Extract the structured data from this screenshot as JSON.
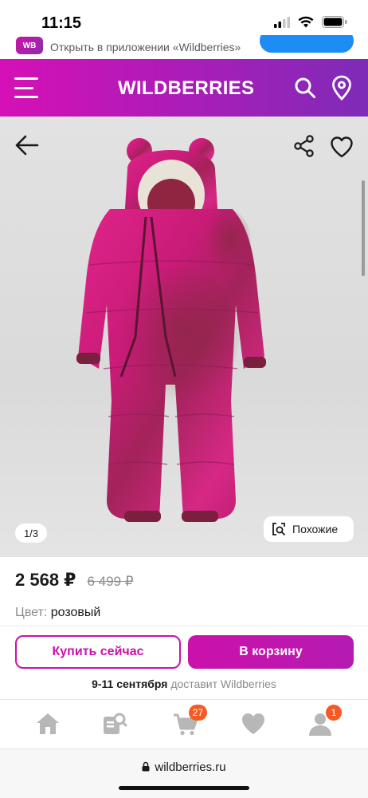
{
  "status_bar": {
    "time": "11:15"
  },
  "app_banner": {
    "text": "Открыть в приложении «Wildberries»",
    "logo": "WB"
  },
  "header": {
    "logo": "WILDBERRIES"
  },
  "gallery": {
    "counter": "1/3",
    "similar_label": "Похожие"
  },
  "product": {
    "price": "2 568 ₽",
    "old_price": "6 499 ₽",
    "color_label": "Цвет:",
    "color_value": "розовый"
  },
  "actions": {
    "buy_now": "Купить сейчас",
    "to_cart": "В корзину",
    "delivery_date": "9-11 сентября",
    "delivery_text": " доставит Wildberries"
  },
  "bottom_nav": {
    "items": [
      {
        "icon": "home-icon"
      },
      {
        "icon": "catalog-search-icon"
      },
      {
        "icon": "cart-icon",
        "badge": "27"
      },
      {
        "icon": "heart-icon"
      },
      {
        "icon": "profile-icon",
        "badge": "1"
      }
    ]
  },
  "browser": {
    "url": "wildberries.ru"
  },
  "colors": {
    "brand": "#cb11ab",
    "header_end": "#7e2bb8",
    "badge": "#f55a25",
    "link_blue": "#1d8cf5"
  }
}
